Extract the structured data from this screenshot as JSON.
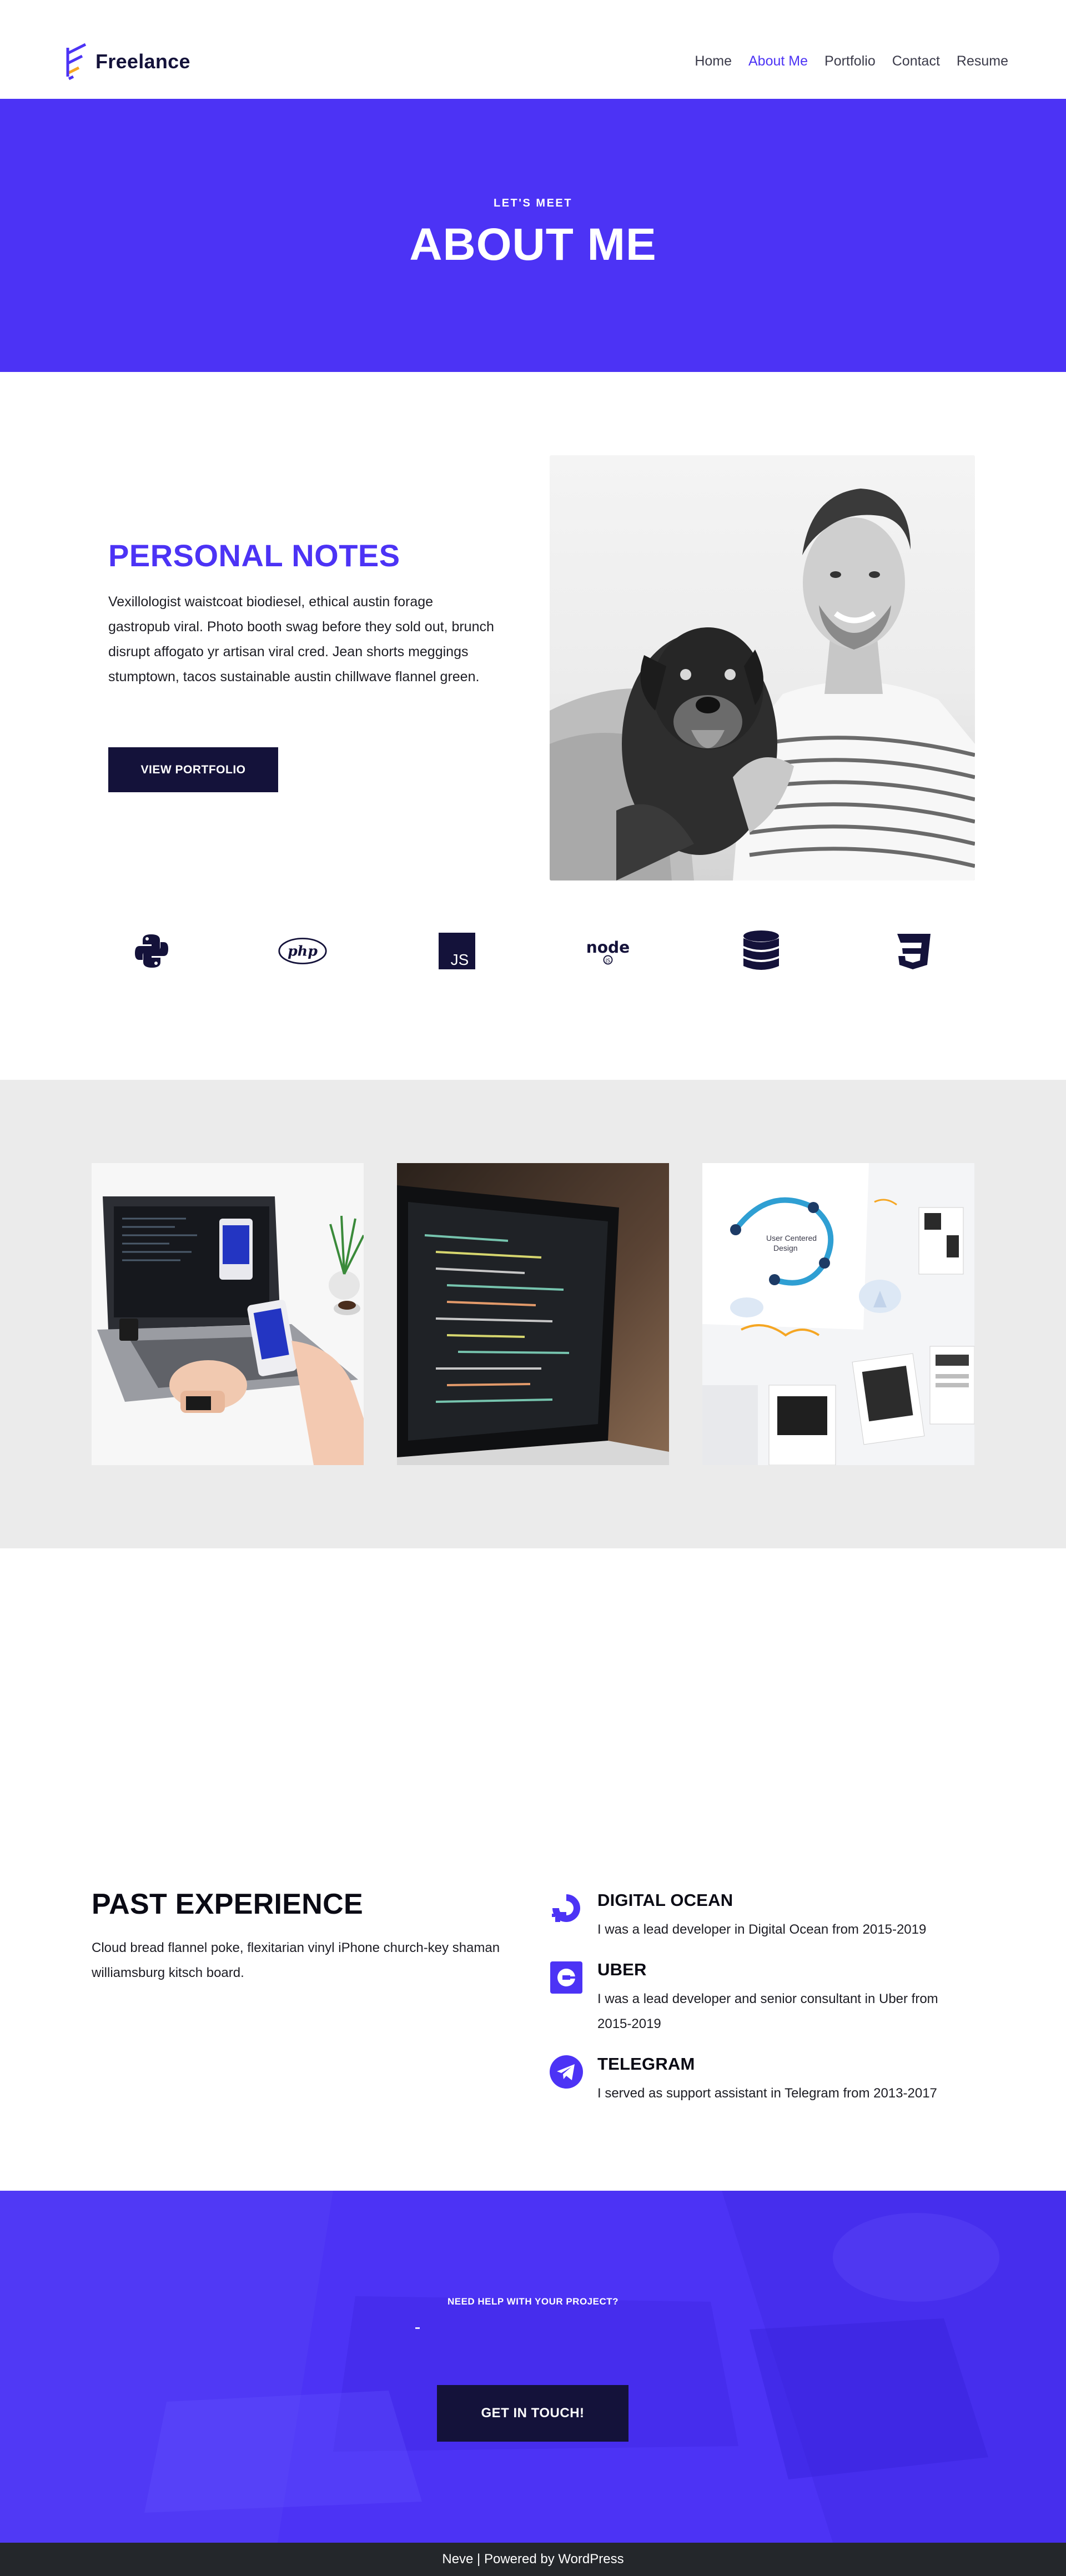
{
  "header": {
    "logo_text": "Freelance",
    "nav": [
      "Home",
      "About Me",
      "Portfolio",
      "Contact",
      "Resume"
    ],
    "active_nav": "About Me"
  },
  "hero": {
    "kicker": "LET'S MEET",
    "title": "ABOUT ME"
  },
  "notes": {
    "title": "PERSONAL NOTES",
    "text": "Vexillologist waistcoat biodiesel, ethical austin forage gastropub viral. Photo booth swag before they sold out, brunch disrupt affogato yr artisan viral cred. Jean shorts meggings stumptown, tacos sustainable austin chillwave flannel green.",
    "button": "VIEW PORTFOLIO"
  },
  "tech_icons": [
    "python-icon",
    "php-icon",
    "javascript-icon",
    "nodejs-icon",
    "database-icon",
    "css3-icon"
  ],
  "gallery": [
    "laptop-phones-photo",
    "code-laptop-photo",
    "ux-wireframes-photo"
  ],
  "experience": {
    "title": "PAST EXPERIENCE",
    "text": "Cloud bread flannel poke, flexitarian vinyl iPhone church-key shaman williamsburg kitsch board.",
    "jobs": [
      {
        "icon": "digitalocean-icon",
        "title": "DIGITAL OCEAN",
        "desc": "I was a lead developer in Digital Ocean from 2015-2019"
      },
      {
        "icon": "uber-icon",
        "title": "UBER",
        "desc": "I was a lead developer and senior consultant in Uber from 2015-2019"
      },
      {
        "icon": "telegram-icon",
        "title": "TELEGRAM",
        "desc": "I served as support assistant in Telegram from 2013-2017"
      }
    ]
  },
  "cta": {
    "kicker": "NEED HELP WITH YOUR PROJECT?",
    "button": "GET IN TOUCH!"
  },
  "footer": {
    "text": "Neve | Powered by WordPress"
  },
  "colors": {
    "accent": "#4c33f5",
    "dark": "#14123a",
    "gallery_bg": "#ebebeb",
    "footer_bg": "#24272b"
  }
}
